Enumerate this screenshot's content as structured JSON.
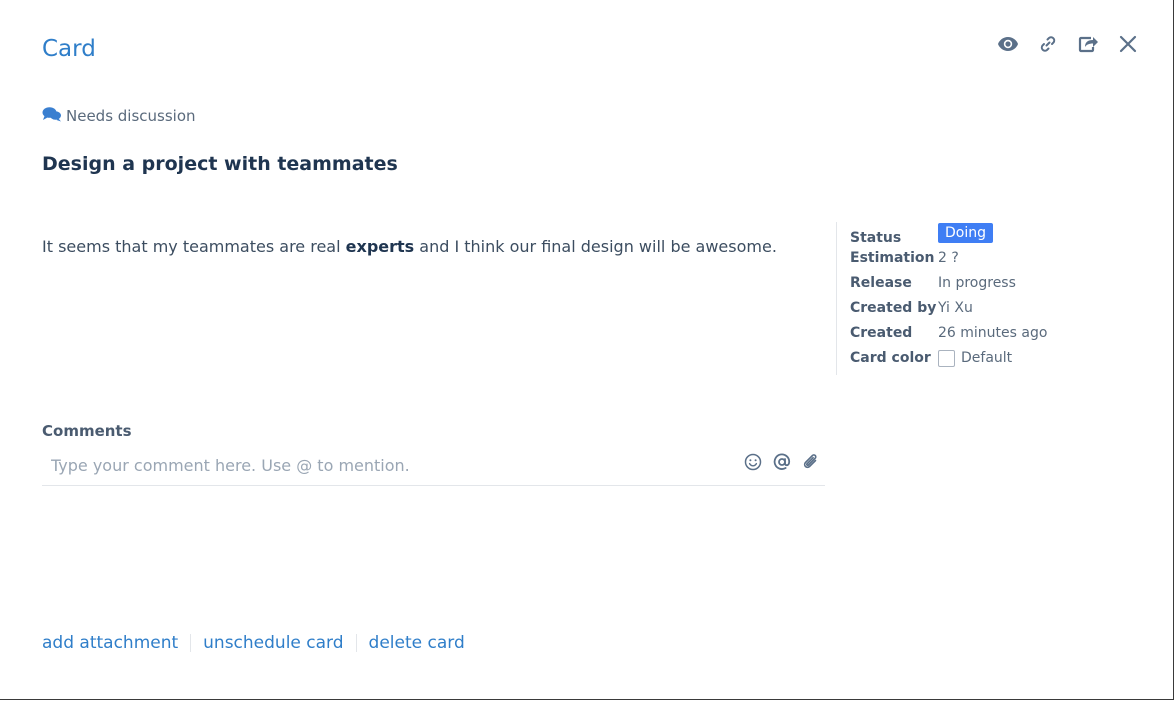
{
  "dialog": {
    "title": "Card"
  },
  "header_actions": [
    {
      "icon": "eye-icon",
      "name": "watch-button"
    },
    {
      "icon": "link-icon",
      "name": "copy-link-button"
    },
    {
      "icon": "share-icon",
      "name": "share-button"
    },
    {
      "icon": "close-icon",
      "name": "close-button"
    }
  ],
  "card": {
    "tag_icon": "comments-icon",
    "tag": "Needs discussion",
    "title": "Design a project with teammates",
    "description": {
      "before": "It seems that my teammates are real ",
      "bold": "experts",
      "after": " and I think our final design will be awesome."
    }
  },
  "sidebar": {
    "status_label": "Status",
    "status_value": "Doing",
    "estimation_label": "Estimation",
    "estimation_value": "2 ?",
    "release_label": "Release",
    "release_value": "In progress",
    "created_by_label": "Created by",
    "created_by_value": "Yi Xu",
    "created_label": "Created",
    "created_value": "26 minutes ago",
    "card_color_label": "Card color",
    "card_color_value": "Default"
  },
  "comments": {
    "label": "Comments",
    "placeholder": "Type your comment here. Use @ to mention.",
    "value": "",
    "tools": [
      "emoji-icon",
      "mention-icon",
      "attachment-icon"
    ]
  },
  "footer": {
    "add_attachment": "add attachment",
    "unschedule_card": "unschedule card",
    "delete_card": "delete card"
  },
  "colors": {
    "accent": "#2f7ec9",
    "status_doing": "#3f7ef4",
    "icon": "#5b7089"
  }
}
